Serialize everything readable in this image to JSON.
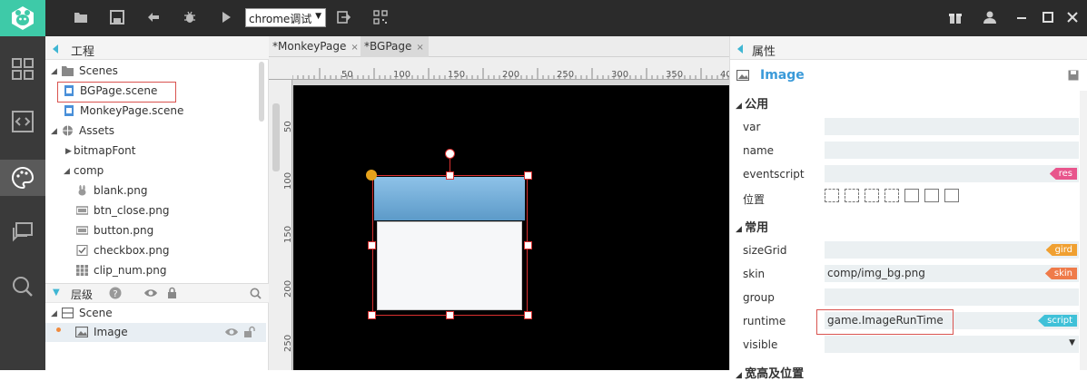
{
  "toolbar": {
    "browser_select": "chrome调试",
    "browser_arrow": "▼"
  },
  "project": {
    "title": "工程",
    "items": [
      {
        "label": "Scenes"
      },
      {
        "label": "BGPage.scene"
      },
      {
        "label": "MonkeyPage.scene"
      },
      {
        "label": "Assets"
      },
      {
        "label": "bitmapFont"
      },
      {
        "label": "comp"
      },
      {
        "label": "blank.png"
      },
      {
        "label": "btn_close.png"
      },
      {
        "label": "button.png"
      },
      {
        "label": "checkbox.png"
      },
      {
        "label": "clip_num.png"
      }
    ]
  },
  "layers": {
    "title": "层级",
    "items": [
      {
        "label": "Scene"
      },
      {
        "label": "Image"
      }
    ]
  },
  "editor": {
    "tabs": [
      {
        "label": "*MonkeyPage",
        "close": "×"
      },
      {
        "label": "*BGPage",
        "close": "×"
      }
    ],
    "hruler": [
      "50",
      "100",
      "150",
      "200",
      "250",
      "300",
      "350",
      "40"
    ],
    "vruler": [
      "50",
      "100",
      "150",
      "200",
      "250"
    ]
  },
  "properties": {
    "title": "属性",
    "component": "Image",
    "sections": {
      "common": "公用",
      "usual": "常用",
      "size": "宽高及位置"
    },
    "fields": {
      "var": {
        "label": "var",
        "value": ""
      },
      "name": {
        "label": "name",
        "value": ""
      },
      "eventscript": {
        "label": "eventscript",
        "value": "",
        "tag": "res"
      },
      "position": {
        "label": "位置"
      },
      "sizeGrid": {
        "label": "sizeGrid",
        "value": "",
        "tag": "gird"
      },
      "skin": {
        "label": "skin",
        "value": "comp/img_bg.png",
        "tag": "skin"
      },
      "group": {
        "label": "group",
        "value": ""
      },
      "runtime": {
        "label": "runtime",
        "value": "game.ImageRunTime",
        "tag": "script"
      },
      "visible": {
        "label": "visible",
        "value": "",
        "arrow": "▼"
      }
    },
    "tag_colors": {
      "res": "#e8558c",
      "gird": "#f0a031",
      "skin": "#ef7b4a",
      "script": "#3fc1d8"
    }
  }
}
